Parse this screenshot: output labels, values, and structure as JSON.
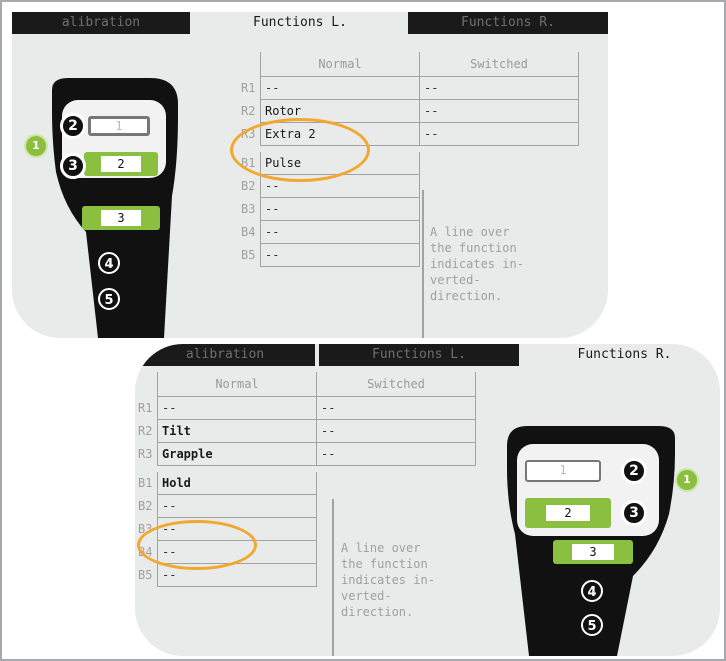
{
  "top": {
    "tabs": [
      "alibration",
      "Functions L.",
      "Functions R."
    ],
    "active_tab": "Functions L.",
    "table": {
      "headers": [
        "Normal",
        "Switched"
      ],
      "rows": [
        {
          "key": "R1",
          "normal": "--",
          "switched": "--"
        },
        {
          "key": "R2",
          "normal": "Rotor",
          "switched": "--"
        },
        {
          "key": "R3",
          "normal": "Extra 2",
          "switched": "--"
        },
        {
          "key": "B1",
          "normal": "Pulse"
        },
        {
          "key": "B2",
          "normal": "--"
        },
        {
          "key": "B3",
          "normal": "--"
        },
        {
          "key": "B4",
          "normal": "--"
        },
        {
          "key": "B5",
          "normal": "--"
        }
      ]
    },
    "note": [
      "A line over",
      "the function",
      "indicates in-",
      "verted-",
      "direction."
    ],
    "controller": {
      "badge": "1",
      "btn2": "2",
      "btn3": "3",
      "btn4": "4",
      "btn5": "5",
      "box1": "1",
      "box2": "2",
      "box3": "3"
    }
  },
  "bottom": {
    "tabs": [
      "alibration",
      "Functions L.",
      "Functions R."
    ],
    "active_tab": "Functions R.",
    "table": {
      "headers": [
        "Normal",
        "Switched"
      ],
      "rows": [
        {
          "key": "R1",
          "normal": "--",
          "switched": "--"
        },
        {
          "key": "R2",
          "normal": "Tilt",
          "switched": "--"
        },
        {
          "key": "R3",
          "normal": "Grapple",
          "switched": "--"
        },
        {
          "key": "B1",
          "normal": "Hold"
        },
        {
          "key": "B2",
          "normal": "--"
        },
        {
          "key": "B3",
          "normal": "--"
        },
        {
          "key": "B4",
          "normal": "--"
        },
        {
          "key": "B5",
          "normal": "--"
        }
      ]
    },
    "note": [
      "A line over",
      "the function",
      "indicates in-",
      "verted-",
      "direction."
    ],
    "controller": {
      "badge": "1",
      "btn2": "2",
      "btn3": "3",
      "btn4": "4",
      "btn5": "5",
      "box1": "1",
      "box2": "2",
      "box3": "3"
    }
  },
  "colors": {
    "green": "#8bbf3f",
    "highlight": "#f2a72e",
    "dark": "#1a1a1a",
    "panel": "#e9eaea"
  }
}
